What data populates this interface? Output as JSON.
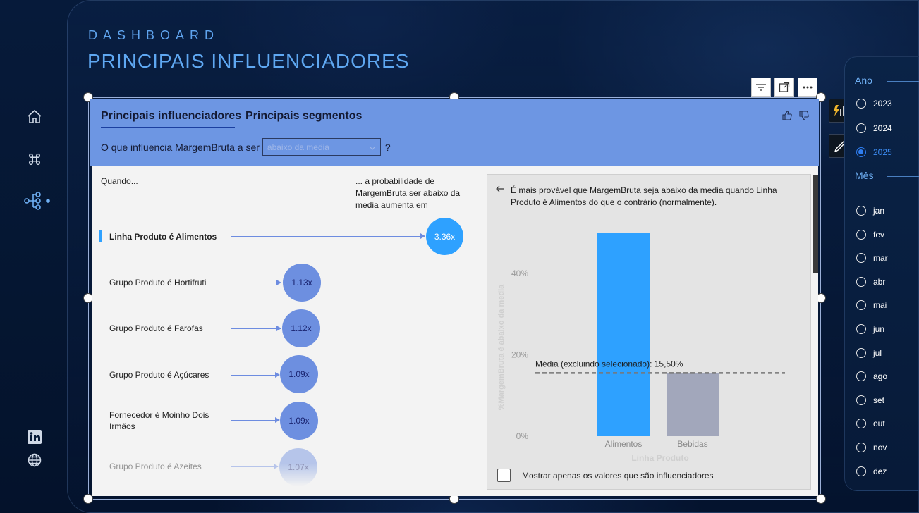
{
  "header": {
    "eyebrow": "DASHBOARD",
    "title": "PRINCIPAIS INFLUENCIADORES"
  },
  "sidebar": {
    "items": [
      {
        "icon": "home-icon"
      },
      {
        "icon": "command-icon"
      },
      {
        "icon": "decomposition-tree-icon",
        "active": true
      },
      {
        "icon": "linkedin-icon"
      },
      {
        "icon": "globe-icon"
      }
    ]
  },
  "visual": {
    "tabs": [
      "Principais influenciadores",
      "Principais segmentos"
    ],
    "active_tab": 0,
    "question_prefix": "O que influencia MargemBruta a ser",
    "dropdown_value": "abaixo da media",
    "question_suffix": "?",
    "col_when": "Quando...",
    "col_prob": "... a probabilidade de MargemBruta ser abaixo da media aumenta em",
    "influencers": [
      {
        "label": "Linha Produto é Alimentos",
        "value": "3.36x",
        "selected": true
      },
      {
        "label": "Grupo Produto é Hortifruti",
        "value": "1.13x"
      },
      {
        "label": "Grupo Produto é Farofas",
        "value": "1.12x"
      },
      {
        "label": "Grupo Produto é Açúcares",
        "value": "1.09x"
      },
      {
        "label": "Fornecedor é Moinho Dois Irmãos",
        "value": "1.09x"
      },
      {
        "label": "Grupo Produto é Azeites",
        "value": "1.07x"
      }
    ],
    "detail": {
      "description": "É mais provável que MargemBruta seja abaixo da media quando Linha Produto é Alimentos do que o contrário (normalmente).",
      "average_label": "Média (excluindo selecionado): 15,50%",
      "checkbox_label": "Mostrar apenas os valores que são influenciadores"
    }
  },
  "chart_data": {
    "type": "bar",
    "categories": [
      "Alimentos",
      "Bebidas"
    ],
    "values": [
      50,
      15.5
    ],
    "colors": [
      "#2ea1ff",
      "#a2a7bb"
    ],
    "xlabel": "Linha Produto",
    "ylabel": "%MargemBruta é abaixo da media",
    "yticks": [
      "0%",
      "20%",
      "40%"
    ],
    "ylim": [
      0,
      50
    ],
    "average": 15.5
  },
  "slicer": {
    "year_title": "Ano",
    "years": [
      "2023",
      "2024",
      "2025"
    ],
    "selected_year": "2025",
    "month_title": "Mês",
    "months": [
      "jan",
      "fev",
      "mar",
      "abr",
      "mai",
      "jun",
      "jul",
      "ago",
      "set",
      "out",
      "nov",
      "dez"
    ]
  },
  "colors": {
    "accent": "#5fa8f2",
    "visual_header": "#6d96e3",
    "bubble_primary": "#2ea1ff",
    "bubble_secondary": "#6d96e3"
  }
}
